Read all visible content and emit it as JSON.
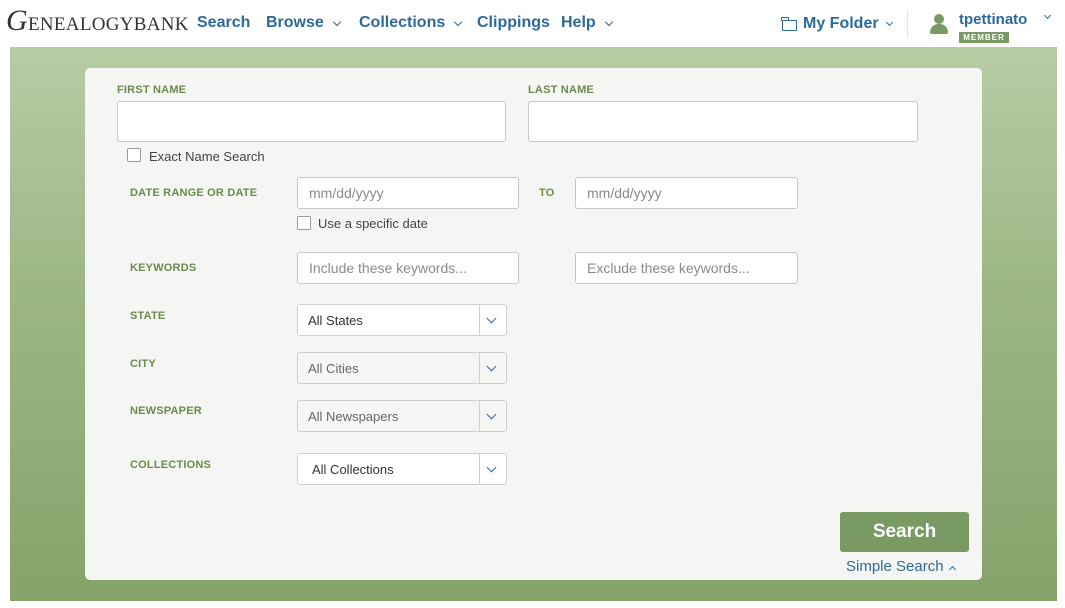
{
  "header": {
    "logo_big_letter": "G",
    "logo_text": "ENEALOGYBANK",
    "nav": [
      {
        "label": "Search"
      },
      {
        "label": "Browse"
      },
      {
        "label": "Collections"
      },
      {
        "label": "Clippings"
      },
      {
        "label": "Help"
      }
    ],
    "my_folder": "My Folder",
    "username": "tpettinato",
    "member_badge": "MEMBER"
  },
  "form": {
    "first_name_label": "FIRST NAME",
    "first_name_value": "",
    "last_name_label": "LAST NAME",
    "last_name_value": "",
    "exact_name_label": "Exact Name Search",
    "date_range_label": "DATE RANGE OR DATE",
    "date_from_placeholder": "mm/dd/yyyy",
    "to_label": "TO",
    "date_to_placeholder": "mm/dd/yyyy",
    "specific_date_label": "Use a specific date",
    "keywords_label": "KEYWORDS",
    "include_placeholder": "Include these keywords...",
    "exclude_placeholder": "Exclude these keywords...",
    "state_label": "STATE",
    "state_value": "All States",
    "city_label": "CITY",
    "city_value": "All Cities",
    "newspaper_label": "NEWSPAPER",
    "newspaper_value": "All Newspapers",
    "collections_label": "COLLECTIONS",
    "collections_value": "All Collections",
    "search_button": "Search",
    "simple_search_link": "Simple Search"
  },
  "colors": {
    "brand_blue": "#2d6a9c",
    "brand_green": "#7a9a64",
    "label_green": "#6b8a4e"
  }
}
